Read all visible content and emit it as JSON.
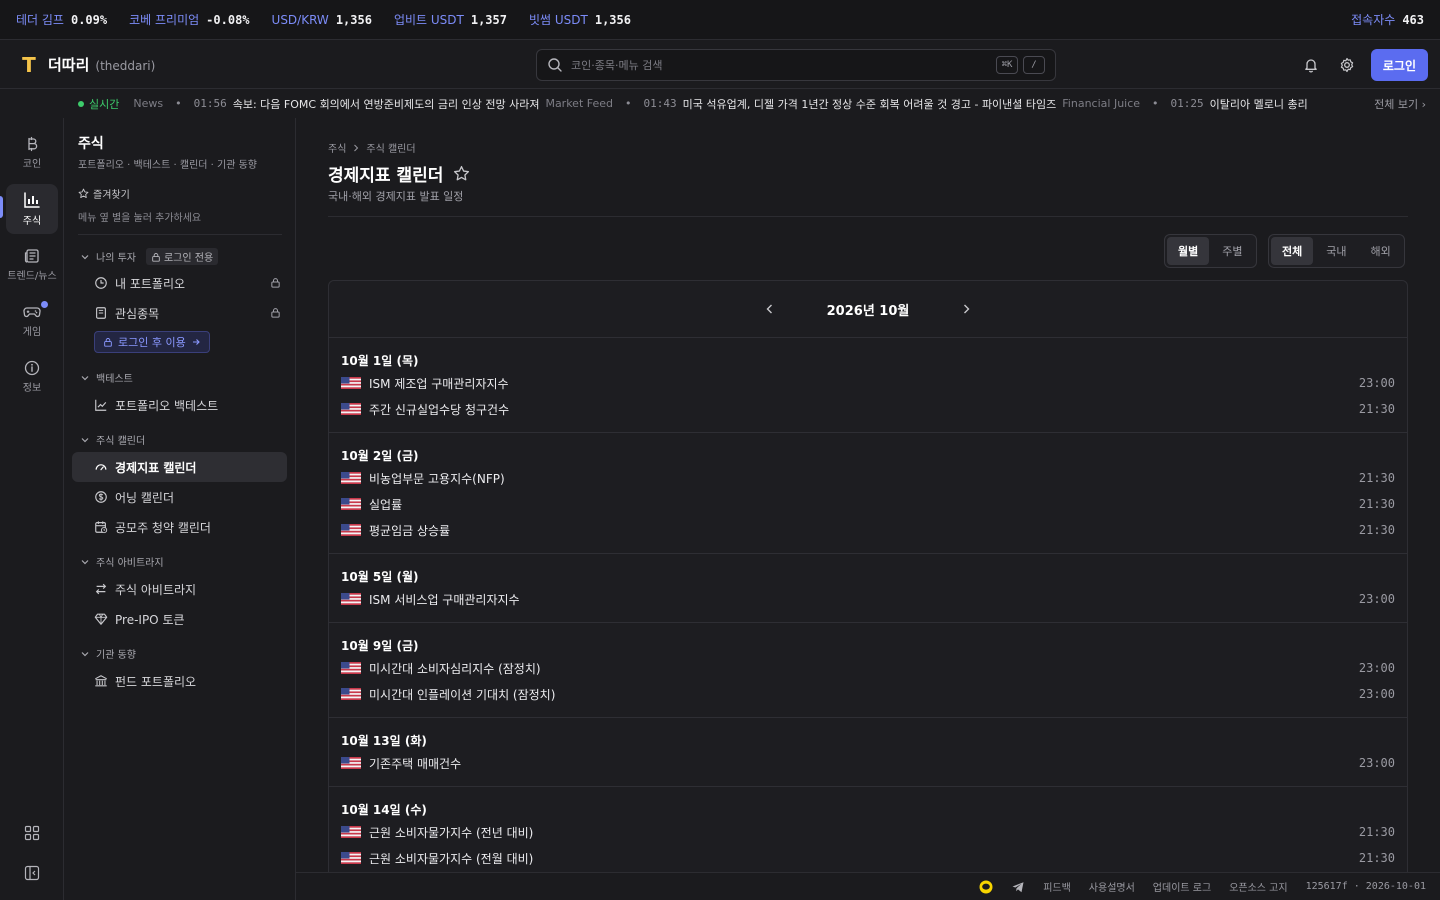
{
  "ticker": {
    "items": [
      {
        "label": "테더 김프",
        "value": "0.09%"
      },
      {
        "label": "코베 프리미엄",
        "value": "-0.08%"
      },
      {
        "label": "USD/KRW",
        "value": "1,356"
      },
      {
        "label": "업비트 USDT",
        "value": "1,357"
      },
      {
        "label": "빗썸 USDT",
        "value": "1,356"
      }
    ],
    "online_label": "접속자수",
    "online_value": "463"
  },
  "header": {
    "logo_letter": "T",
    "brand": "더따리",
    "brand_sub": "(theddari)",
    "search_placeholder": "코인·종목·메뉴 검색",
    "shortcut": "⌘K",
    "shortcut2": "/",
    "login_label": "로그인"
  },
  "newsbar": {
    "live_label": "실시간",
    "items": [
      {
        "time": "",
        "title": "",
        "source": "News"
      },
      {
        "time": "01:56",
        "title": "속보: 다음 FOMC 회의에서 연방준비제도의 금리 인상 전망 사라져",
        "source": "Market Feed"
      },
      {
        "time": "01:43",
        "title": "미국 석유업계, 디젤 가격 1년간 정상 수준 회복 어려울 것 경고 - 파이낸셜 타임즈",
        "source": "Financial Juice"
      },
      {
        "time": "01:25",
        "title": "이탈리아 멜로니 총리",
        "source": ""
      }
    ],
    "see_all": "전체 보기 ›"
  },
  "rail": {
    "items": [
      {
        "label": "코인",
        "icon": "bitcoin-icon"
      },
      {
        "label": "주식",
        "icon": "stock-chart-icon"
      },
      {
        "label": "트렌드/뉴스",
        "icon": "newspaper-icon"
      },
      {
        "label": "게임",
        "icon": "gamepad-icon"
      },
      {
        "label": "정보",
        "icon": "info-icon"
      }
    ]
  },
  "sidebar": {
    "title": "주식",
    "subtitle": "포트폴리오 · 백테스트 · 캘린더 · 기관 동향",
    "favorites_label": "즐겨찾기",
    "favorites_hint": "메뉴 옆 별을 눌러 추가하세요",
    "sections": {
      "my_invest": "나의 투자",
      "login_only": "로그인 전용",
      "backtest": "백테스트",
      "calendar": "주식 캘린더",
      "arbitrage": "주식 아비트라지",
      "institution": "기관 동향"
    },
    "items": {
      "my_portfolio": "내 포트폴리오",
      "watchlist": "관심종목",
      "login_use": "로그인 후 이용",
      "portfolio_backtest": "포트폴리오 백테스트",
      "econ_calendar": "경제지표 캘린더",
      "earning_calendar": "어닝 캘린더",
      "ipo_calendar": "공모주 청약 캘린더",
      "stock_arbitrage": "주식 아비트라지",
      "pre_ipo": "Pre-IPO 토큰",
      "fund_portfolio": "펀드 포트폴리오"
    }
  },
  "main": {
    "breadcrumb": [
      "주식",
      "주식 캘린더"
    ],
    "title": "경제지표 캘린더",
    "description": "국내·해외 경제지표 발표 일정",
    "view_toggle": [
      "월별",
      "주별"
    ],
    "region_toggle": [
      "전체",
      "국내",
      "해외"
    ],
    "month": "2026년 10월",
    "days": [
      {
        "date": "10월 1일 (목)",
        "events": [
          {
            "name": "ISM 제조업 구매관리자지수",
            "time": "23:00",
            "country": "US"
          },
          {
            "name": "주간 신규실업수당 청구건수",
            "time": "21:30",
            "country": "US"
          }
        ]
      },
      {
        "date": "10월 2일 (금)",
        "events": [
          {
            "name": "비농업부문 고용지수(NFP)",
            "time": "21:30",
            "country": "US"
          },
          {
            "name": "실업률",
            "time": "21:30",
            "country": "US"
          },
          {
            "name": "평균임금 상승률",
            "time": "21:30",
            "country": "US"
          }
        ]
      },
      {
        "date": "10월 5일 (월)",
        "events": [
          {
            "name": "ISM 서비스업 구매관리자지수",
            "time": "23:00",
            "country": "US"
          }
        ]
      },
      {
        "date": "10월 9일 (금)",
        "events": [
          {
            "name": "미시간대 소비자심리지수 (잠정치)",
            "time": "23:00",
            "country": "US"
          },
          {
            "name": "미시간대 인플레이션 기대치 (잠정치)",
            "time": "23:00",
            "country": "US"
          }
        ]
      },
      {
        "date": "10월 13일 (화)",
        "events": [
          {
            "name": "기존주택 매매건수",
            "time": "23:00",
            "country": "US"
          }
        ]
      },
      {
        "date": "10월 14일 (수)",
        "events": [
          {
            "name": "근원 소비자물가지수 (전년 대비)",
            "time": "21:30",
            "country": "US"
          },
          {
            "name": "근원 소비자물가지수 (전월 대비)",
            "time": "21:30",
            "country": "US"
          }
        ]
      }
    ]
  },
  "footer": {
    "links": [
      "피드백",
      "사용설명서",
      "업데이트 로그",
      "오픈소스 고지"
    ],
    "build": "125617f · 2026-10-01"
  },
  "colors": {
    "accent": "#5b6cf0",
    "live": "#3dcc6b",
    "logo": "#f5c44a"
  }
}
